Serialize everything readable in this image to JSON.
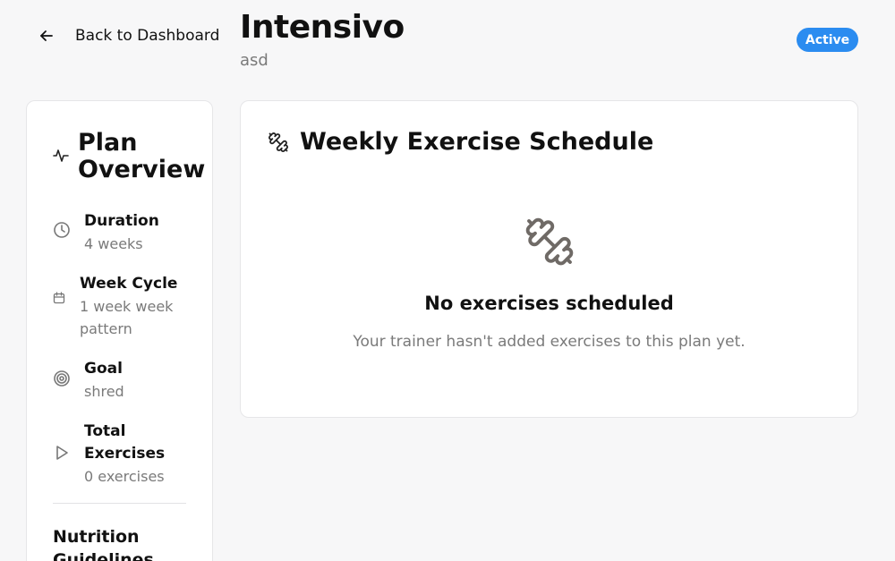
{
  "header": {
    "back_label": "Back to Dashboard",
    "title": "Intensivo",
    "subtitle": "asd",
    "status": "Active",
    "status_color": "#2b8cf0"
  },
  "sidebar": {
    "title": "Plan Overview",
    "items": [
      {
        "icon": "clock-icon",
        "label": "Duration",
        "value": "4 weeks"
      },
      {
        "icon": "calendar-icon",
        "label": "Week Cycle",
        "value": "1 week week pattern"
      },
      {
        "icon": "target-icon",
        "label": "Goal",
        "value": "shred"
      },
      {
        "icon": "play-icon",
        "label": "Total Exercises",
        "value": "0 exercises"
      }
    ],
    "nutrition_title": "Nutrition Guidelines"
  },
  "schedule": {
    "title": "Weekly Exercise Schedule",
    "empty_title": "No exercises scheduled",
    "empty_desc": "Your trainer hasn't added exercises to this plan yet."
  }
}
